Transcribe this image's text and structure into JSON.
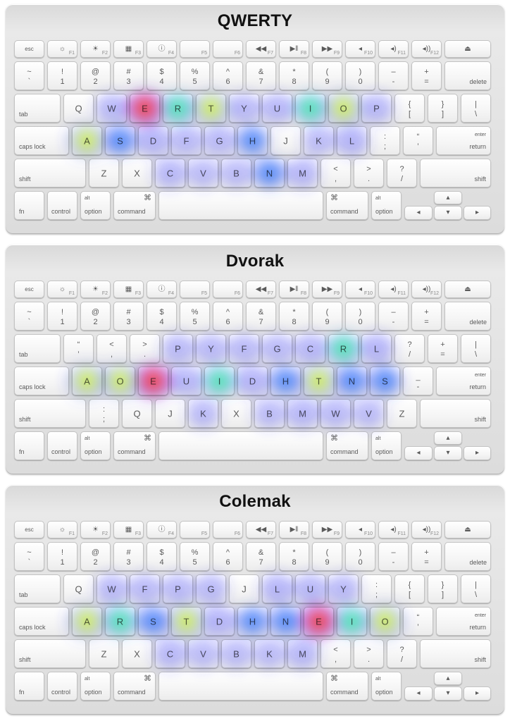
{
  "layouts": [
    {
      "title": "QWERTY",
      "rows": {
        "top": [
          "Q",
          "W",
          "E",
          "R",
          "T",
          "Y",
          "U",
          "I",
          "O",
          "P",
          [
            "{",
            "["
          ],
          [
            "}",
            "]"
          ],
          [
            "|",
            "\\"
          ]
        ],
        "home": [
          "A",
          "S",
          "D",
          "F",
          "G",
          "H",
          "J",
          "K",
          "L",
          [
            ":",
            ";"
          ],
          [
            "“",
            "’"
          ]
        ],
        "bottom": [
          "Z",
          "X",
          "C",
          "V",
          "B",
          "N",
          "M",
          [
            "<",
            ","
          ],
          [
            ">",
            "."
          ],
          [
            "?",
            "/"
          ]
        ]
      },
      "heat": [
        [
          "E",
          1.0
        ],
        [
          "A",
          0.75
        ],
        [
          "T",
          0.75
        ],
        [
          "O",
          0.75
        ],
        [
          "R",
          0.45
        ],
        [
          "I",
          0.4
        ],
        [
          "N",
          0.35
        ],
        [
          "S",
          0.35
        ],
        [
          "H",
          0.3
        ],
        [
          "L",
          0.25
        ],
        [
          "D",
          0.25
        ],
        [
          "U",
          0.2
        ],
        [
          "C",
          0.2
        ],
        [
          "M",
          0.2
        ],
        [
          "W",
          0.15
        ],
        [
          "F",
          0.15
        ],
        [
          "Y",
          0.15
        ],
        [
          "G",
          0.15
        ],
        [
          "P",
          0.15
        ],
        [
          "B",
          0.1
        ],
        [
          "V",
          0.1
        ],
        [
          "K",
          0.1
        ]
      ]
    },
    {
      "title": "Dvorak",
      "rows": {
        "top": [
          [
            "“",
            "’"
          ],
          [
            "<",
            ","
          ],
          [
            ">",
            "."
          ],
          "P",
          "Y",
          "F",
          "G",
          "C",
          "R",
          "L",
          [
            "?",
            "/"
          ],
          [
            "+",
            "="
          ],
          [
            "|",
            "\\"
          ]
        ],
        "home": [
          "A",
          "O",
          "E",
          "U",
          "I",
          "D",
          "H",
          "T",
          "N",
          "S",
          [
            "_",
            "-"
          ]
        ],
        "bottom": [
          [
            ":",
            ";"
          ],
          "Q",
          "J",
          "K",
          "X",
          "B",
          "M",
          "W",
          "V",
          "Z"
        ]
      },
      "heat": [
        [
          "E",
          1.0
        ],
        [
          "A",
          0.75
        ],
        [
          "O",
          0.75
        ],
        [
          "T",
          0.75
        ],
        [
          "R",
          0.45
        ],
        [
          "I",
          0.4
        ],
        [
          "N",
          0.35
        ],
        [
          "S",
          0.35
        ],
        [
          "H",
          0.3
        ],
        [
          "L",
          0.25
        ],
        [
          "D",
          0.25
        ],
        [
          "U",
          0.2
        ],
        [
          "C",
          0.2
        ],
        [
          "M",
          0.2
        ],
        [
          "W",
          0.15
        ],
        [
          "F",
          0.15
        ],
        [
          "Y",
          0.15
        ],
        [
          "G",
          0.15
        ],
        [
          "P",
          0.15
        ],
        [
          "B",
          0.1
        ],
        [
          "V",
          0.1
        ],
        [
          "K",
          0.1
        ]
      ]
    },
    {
      "title": "Colemak",
      "rows": {
        "top": [
          "Q",
          "W",
          "F",
          "P",
          "G",
          "J",
          "L",
          "U",
          "Y",
          [
            ":",
            ";"
          ],
          [
            "{",
            "["
          ],
          [
            "}",
            "]"
          ],
          [
            "|",
            "\\"
          ]
        ],
        "home": [
          "A",
          "R",
          "S",
          "T",
          "D",
          "H",
          "N",
          "E",
          "I",
          "O",
          [
            "“",
            "’"
          ]
        ],
        "bottom": [
          "Z",
          "X",
          "C",
          "V",
          "B",
          "K",
          "M",
          [
            "<",
            ","
          ],
          [
            ">",
            "."
          ],
          [
            "?",
            "/"
          ]
        ]
      },
      "heat": [
        [
          "E",
          1.0
        ],
        [
          "A",
          0.75
        ],
        [
          "T",
          0.75
        ],
        [
          "O",
          0.75
        ],
        [
          "R",
          0.45
        ],
        [
          "I",
          0.4
        ],
        [
          "N",
          0.35
        ],
        [
          "S",
          0.35
        ],
        [
          "H",
          0.3
        ],
        [
          "L",
          0.25
        ],
        [
          "D",
          0.25
        ],
        [
          "U",
          0.2
        ],
        [
          "C",
          0.2
        ],
        [
          "M",
          0.2
        ],
        [
          "W",
          0.15
        ],
        [
          "F",
          0.15
        ],
        [
          "Y",
          0.15
        ],
        [
          "G",
          0.15
        ],
        [
          "P",
          0.15
        ],
        [
          "B",
          0.1
        ],
        [
          "V",
          0.1
        ],
        [
          "K",
          0.1
        ]
      ]
    }
  ],
  "common": {
    "fn_row": [
      {
        "label": "esc",
        "sub": ""
      },
      {
        "label": "☼",
        "sub": "F1"
      },
      {
        "label": "☀",
        "sub": "F2"
      },
      {
        "label": "▦",
        "sub": "F3"
      },
      {
        "label": "ⓘ",
        "sub": "F4"
      },
      {
        "label": "",
        "sub": "F5"
      },
      {
        "label": "",
        "sub": "F6"
      },
      {
        "label": "◀◀",
        "sub": "F7"
      },
      {
        "label": "▶‖",
        "sub": "F8"
      },
      {
        "label": "▶▶",
        "sub": "F9"
      },
      {
        "label": "◂",
        "sub": "F10"
      },
      {
        "label": "◂)",
        "sub": "F11"
      },
      {
        "label": "◂))",
        "sub": "F12"
      },
      {
        "label": "⏏",
        "sub": ""
      }
    ],
    "num_row": [
      [
        "~",
        "`"
      ],
      [
        "!",
        "1"
      ],
      [
        "@",
        "2"
      ],
      [
        "#",
        "3"
      ],
      [
        "$",
        "4"
      ],
      [
        "%",
        "5"
      ],
      [
        "^",
        "6"
      ],
      [
        "&",
        "7"
      ],
      [
        "*",
        "8"
      ],
      [
        "(",
        "9"
      ],
      [
        ")",
        "0"
      ],
      [
        "–",
        "-"
      ],
      [
        "+",
        "="
      ]
    ],
    "delete": "delete",
    "tab": "tab",
    "caps_lock": "caps lock",
    "enter": "enter",
    "return": "return",
    "shift": "shift",
    "fn": "fn",
    "control": "control",
    "alt": "alt",
    "option": "option",
    "cmd_symbol": "⌘",
    "command": "command",
    "arrow_left": "◂",
    "arrow_right": "▸",
    "arrow_up": "▴",
    "arrow_down": "▾"
  }
}
